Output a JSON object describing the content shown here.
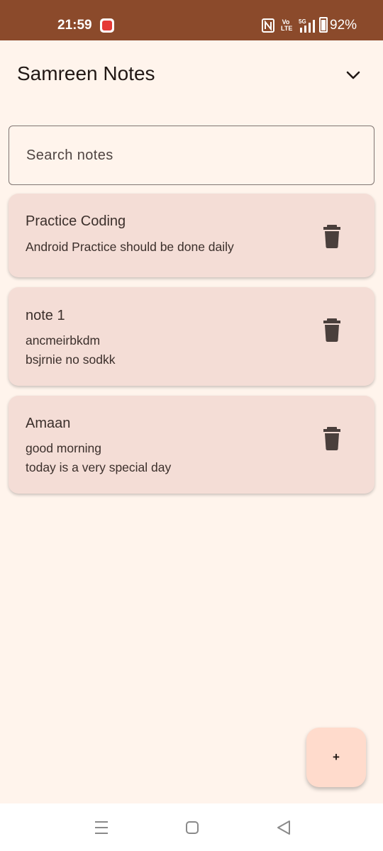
{
  "status_bar": {
    "time": "21:59",
    "battery": "92%",
    "volte_label": "Vo\nLTE",
    "network": "5G",
    "icons": [
      "app-notification-icon",
      "nfc-icon",
      "volte-icon",
      "signal-5g-icon",
      "battery-icon"
    ]
  },
  "header": {
    "title": "Samreen Notes",
    "menu_icon": "chevron-down-icon"
  },
  "search": {
    "placeholder": "Search notes",
    "value": ""
  },
  "notes": [
    {
      "title": "Practice Coding",
      "body": "Android Practice should be done daily"
    },
    {
      "title": "note 1",
      "body": "ancmeirbkdm\nbsjrnie no sodkk"
    },
    {
      "title": "Amaan",
      "body": "good morning\ntoday is a very special day"
    }
  ],
  "fab": {
    "label": "+"
  },
  "nav": {
    "icons": [
      "recents-icon",
      "home-icon",
      "back-icon"
    ]
  },
  "colors": {
    "status_bar": "#8b4a2b",
    "background": "#fff4ec",
    "card": "#f4ddd6",
    "fab": "#ffdbcc",
    "icon": "#4a3f3c"
  }
}
